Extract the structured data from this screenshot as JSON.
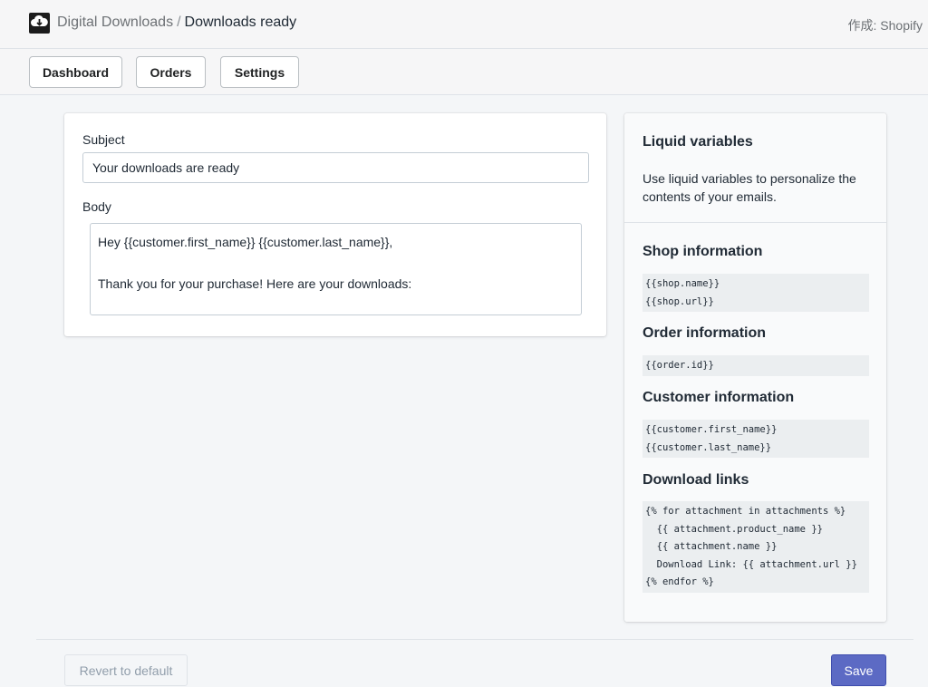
{
  "header": {
    "app_name": "Digital Downloads",
    "separator": "/",
    "page_title": "Downloads ready",
    "byline": "作成: Shopify",
    "logo_icon": "cloud-download-icon"
  },
  "nav": {
    "items": [
      {
        "label": "Dashboard"
      },
      {
        "label": "Orders"
      },
      {
        "label": "Settings"
      }
    ]
  },
  "form": {
    "subject_label": "Subject",
    "subject_value": "Your downloads are ready",
    "body_label": "Body",
    "body_value": "Hey {{customer.first_name}} {{customer.last_name}},\n\nThank you for your purchase! Here are your downloads:"
  },
  "sidebar": {
    "title": "Liquid variables",
    "description": "Use liquid variables to personalize the contents of your emails.",
    "sections": [
      {
        "title": "Shop information",
        "code": "{{shop.name}}\n{{shop.url}}"
      },
      {
        "title": "Order information",
        "code": "{{order.id}}"
      },
      {
        "title": "Customer information",
        "code": "{{customer.first_name}}\n{{customer.last_name}}"
      },
      {
        "title": "Download links",
        "code": "{% for attachment in attachments %}\n  {{ attachment.product_name }}\n  {{ attachment.name }}\n  Download Link: {{ attachment.url }}\n{% endfor %}"
      }
    ]
  },
  "footer": {
    "revert_label": "Revert to default",
    "save_label": "Save"
  },
  "colors": {
    "primary": "#5c6ac4"
  }
}
